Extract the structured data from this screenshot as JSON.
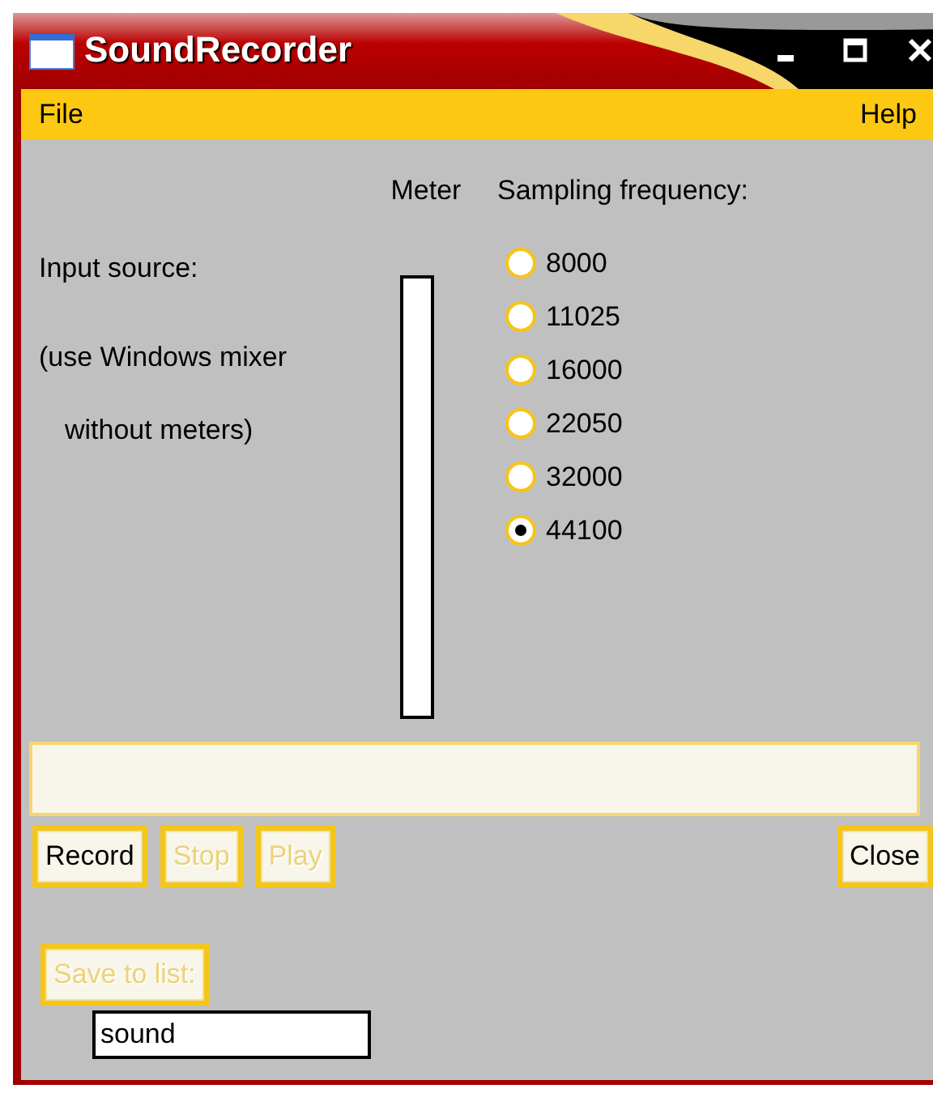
{
  "window": {
    "title": "SoundRecorder"
  },
  "menu": [
    {
      "label": "File"
    },
    {
      "label": "Help"
    }
  ],
  "input_source": {
    "label": "Input source:",
    "note_lines": [
      "(use Windows mixer",
      "without meters)"
    ]
  },
  "meter": {
    "label": "Meter",
    "level": 0
  },
  "sampling": {
    "label": "Sampling frequency:",
    "options": [
      {
        "label": "8000",
        "selected": false
      },
      {
        "label": "11025",
        "selected": false
      },
      {
        "label": "16000",
        "selected": false
      },
      {
        "label": "22050",
        "selected": false
      },
      {
        "label": "32000",
        "selected": false
      },
      {
        "label": "44100",
        "selected": true
      }
    ]
  },
  "transport_buttons": [
    {
      "label": "Record",
      "disabled": false
    },
    {
      "label": "Stop",
      "disabled": true
    },
    {
      "label": "Play",
      "disabled": true
    }
  ],
  "close_button": {
    "label": "Close",
    "disabled": false
  },
  "save_button": {
    "label": "Save to list:",
    "disabled": true
  },
  "name_field": {
    "value": "sound"
  }
}
